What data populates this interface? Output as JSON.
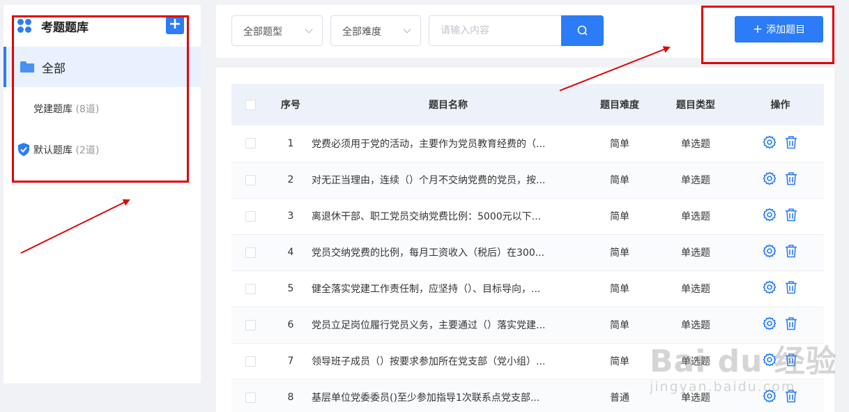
{
  "sidebar": {
    "title": "考题题库",
    "add_label": "+",
    "all_label": "全部",
    "items": [
      {
        "name": "党建题库",
        "count": "(8道)"
      },
      {
        "name": "默认题库",
        "count": "(2道)"
      }
    ]
  },
  "filters": {
    "type_select": "全部题型",
    "difficulty_select": "全部难度",
    "search_placeholder": "请输入内容",
    "add_button": "添加题目",
    "add_button_plus": "+"
  },
  "table": {
    "headers": {
      "index": "序号",
      "name": "题目名称",
      "difficulty": "题目难度",
      "type": "题目类型",
      "ops": "操作"
    },
    "rows": [
      {
        "index": "1",
        "name": "党费必须用于党的活动，主要作为党员教育经费的（...",
        "difficulty": "简单",
        "type": "单选题"
      },
      {
        "index": "2",
        "name": "对无正当理由，连续（）个月不交纳党费的党员，按...",
        "difficulty": "简单",
        "type": "单选题"
      },
      {
        "index": "3",
        "name": "离退休干部、职工党员交纳党费比例：5000元以下...",
        "difficulty": "简单",
        "type": "单选题"
      },
      {
        "index": "4",
        "name": "党员交纳党费的比例，每月工资收入（税后）在300...",
        "difficulty": "简单",
        "type": "单选题"
      },
      {
        "index": "5",
        "name": "健全落实党建工作责任制，应坚持（）、目标导向，...",
        "difficulty": "简单",
        "type": "单选题"
      },
      {
        "index": "6",
        "name": "党员立足岗位履行党员义务，主要通过（）落实党建...",
        "difficulty": "简单",
        "type": "单选题"
      },
      {
        "index": "7",
        "name": "领导班子成员（）按要求参加所在党支部（党小组）...",
        "difficulty": "简单",
        "type": "单选题"
      },
      {
        "index": "8",
        "name": "基层单位党委委员()至少参加指导1次联系点党支部...",
        "difficulty": "普通",
        "type": "单选题"
      }
    ]
  },
  "watermark": {
    "main": "Bai du 经验",
    "sub": "jingyan.baidu.com"
  },
  "colors": {
    "accent": "#2b7cf6",
    "annotation": "#e00000",
    "header_bg": "#edf2fa"
  }
}
